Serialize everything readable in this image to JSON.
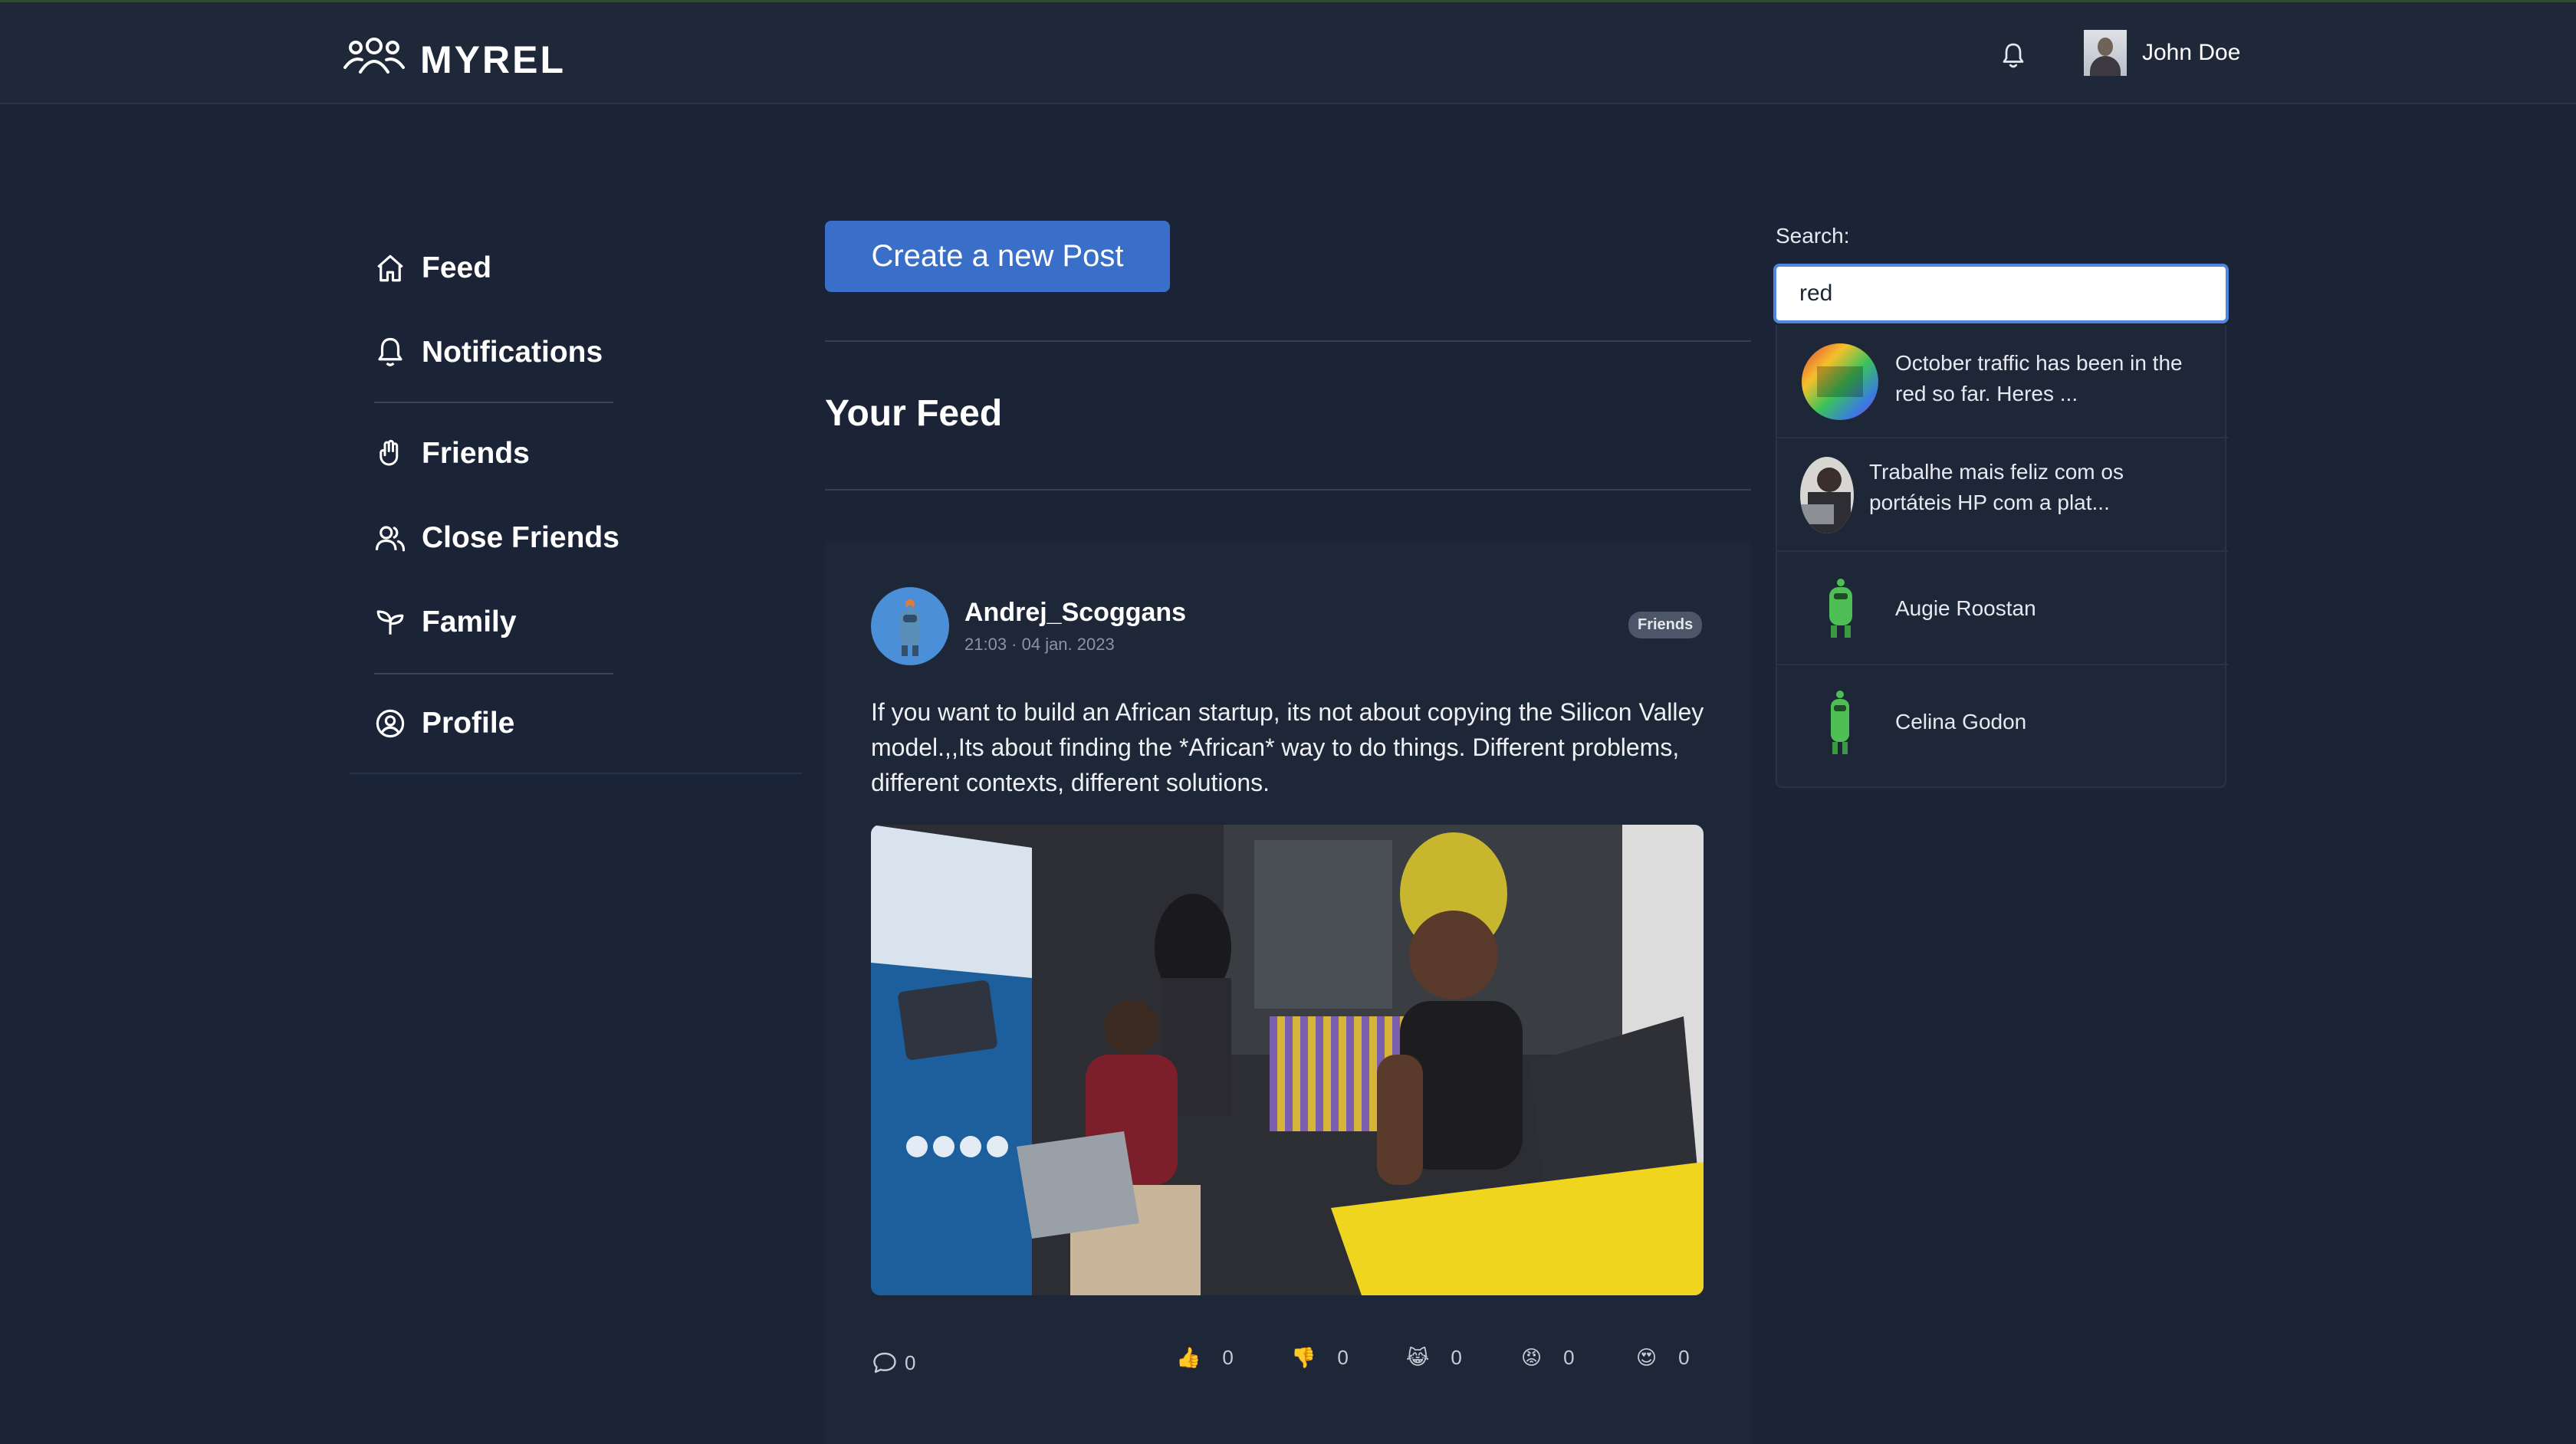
{
  "app": {
    "name": "MYREL"
  },
  "header": {
    "user_name": "John Doe"
  },
  "sidebar": {
    "items": [
      {
        "label": "Feed"
      },
      {
        "label": "Notifications"
      },
      {
        "label": "Friends"
      },
      {
        "label": "Close Friends"
      },
      {
        "label": "Family"
      },
      {
        "label": "Profile"
      }
    ]
  },
  "main": {
    "create_post_label": "Create a new Post",
    "feed_title": "Your Feed"
  },
  "post": {
    "author": "Andrej_Scoggans",
    "timestamp": "21:03 · 04 jan. 2023",
    "audience_badge": "Friends",
    "text": "If you want to build an African startup, its not about copying the Silicon Valley model.,,Its about finding the *African* way to do things. Different problems, different contexts, different solutions.",
    "comments_count": "0",
    "reactions": [
      {
        "icon": "thumbs-up-icon",
        "emoji": "👍",
        "count": "0"
      },
      {
        "icon": "thumbs-down-icon",
        "emoji": "👎",
        "count": "0"
      },
      {
        "icon": "laughing-icon",
        "emoji": "😹",
        "count": "0"
      },
      {
        "icon": "angry-icon",
        "emoji": "😡",
        "count": "0"
      },
      {
        "icon": "heart-eyes-icon",
        "emoji": "😍",
        "count": "0"
      }
    ]
  },
  "search": {
    "label": "Search:",
    "value": "red",
    "results": [
      {
        "text": "October traffic has been in the red so far. Heres ..."
      },
      {
        "text": "Trabalhe mais feliz com os portáteis HP com a plat..."
      },
      {
        "text": "Augie Roostan"
      },
      {
        "text": "Celina Godon"
      }
    ]
  },
  "colors": {
    "background": "#1b2436",
    "card": "#1e2738",
    "primary_button": "#3a6fc9",
    "search_focus": "#4f86e0"
  }
}
